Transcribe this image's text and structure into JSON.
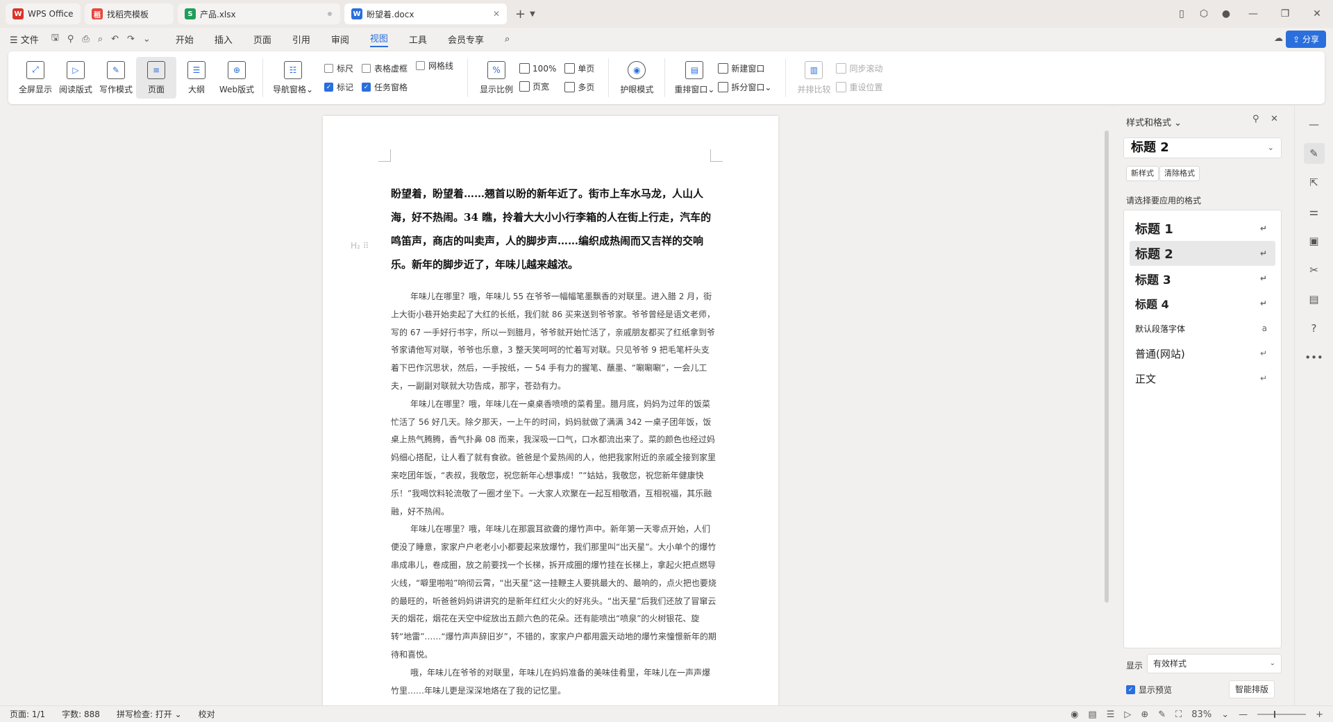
{
  "tabs": [
    {
      "label": "WPS Office",
      "icon": "wps-logo-icon",
      "color": "#d9342b"
    },
    {
      "label": "找稻壳模板",
      "icon": "docer-icon",
      "color": "#e8453c"
    },
    {
      "label": "产品.xlsx",
      "icon": "sheet-icon",
      "color": "#1e9e5a"
    },
    {
      "label": "盼望着.docx",
      "icon": "writer-icon",
      "color": "#2a6fdc"
    }
  ],
  "menu": {
    "file": "文件",
    "items": [
      "开始",
      "插入",
      "页面",
      "引用",
      "审阅",
      "视图",
      "工具",
      "会员专享"
    ],
    "active": "视图",
    "share": "分享"
  },
  "ribbon": {
    "views": [
      {
        "label": "全屏显示",
        "icon": "fullscreen-icon"
      },
      {
        "label": "阅读版式",
        "icon": "read-mode-icon"
      },
      {
        "label": "写作模式",
        "icon": "write-mode-icon"
      },
      {
        "label": "页面",
        "icon": "page-view-icon",
        "active": true
      },
      {
        "label": "大纲",
        "icon": "outline-icon"
      },
      {
        "label": "Web版式",
        "icon": "web-layout-icon"
      }
    ],
    "nav_pane": "导航窗格",
    "checks_col1": [
      {
        "label": "标尺",
        "checked": false
      },
      {
        "label": "标记",
        "checked": true
      }
    ],
    "checks_col2": [
      {
        "label": "表格虚框",
        "checked": false
      },
      {
        "label": "任务窗格",
        "checked": true
      }
    ],
    "checks_col3": [
      {
        "label": "网格线",
        "checked": false
      }
    ],
    "zoom_label": "显示比例",
    "zoom_100": "100%",
    "page_width": "页宽",
    "single_page": "单页",
    "multi_page": "多页",
    "eye_mode": "护眼模式",
    "rearrange": "重排窗口",
    "new_window": "新建窗口",
    "split_window": "拆分窗口",
    "side_by_side": "并排比较",
    "sync_scroll": "同步滚动",
    "reset_pos": "重设位置"
  },
  "document": {
    "heading": "盼望着，盼望着……翘首以盼的新年近了。街市上车水马龙，人山人海，好不热闹。34 瞧，拎着大大小小行李箱的人在街上行走，汽车的鸣笛声，商店的叫卖声，人的脚步声……编织成热闹而又吉祥的交响乐。新年的脚步近了，年味儿越来越浓。",
    "h2_marker": "H₂ ⠿",
    "paragraphs": [
      "年味儿在哪里？哦，年味儿 55 在爷爷一幅幅笔墨飘香的对联里。进入腊 2 月，街上大街小巷开始卖起了大红的长纸，我们就 86 买来送到爷爷家。爷爷曾经是语文老师，写的 67 一手好行书字，所以一到腊月，爷爷就开始忙活了，亲戚朋友都买了红纸拿到爷爷家请他写对联，爷爷也乐意，3 整天笑呵呵的忙着写对联。只见爷爷 9 把毛笔杆头支着下巴作沉思状，然后，一手按纸，一 54 手有力的握笔、蘸墨、“唰唰唰”，一会儿工夫，一副副对联就大功告成，那字，苍劲有力。",
      "年味儿在哪里？哦，年味儿在一桌桌香喷喷的菜肴里。腊月底，妈妈为过年的饭菜忙活了 56 好几天。除夕那天，一上午的时间，妈妈就做了满满 342 一桌子团年饭，饭桌上热气腾腾，香气扑鼻 08 而来，我深吸一口气，口水都流出来了。菜的颜色也经过妈妈细心搭配，让人看了就有食欲。爸爸是个爱热闹的人，他把我家附近的亲戚全接到家里来吃团年饭，“表叔，我敬您，祝您新年心想事成！”“姑姑，我敬您，祝您新年健康快乐！”我喝饮料轮流敬了一圈才坐下。一大家人欢聚在一起互相敬酒，互相祝福，其乐融融，好不热闹。",
      "年味儿在哪里？哦，年味儿在那震耳欲聋的爆竹声中。新年第一天零点开始，人们便没了睡意，家家户户老老小小都要起来放爆竹，我们那里叫“出天星”。大小单个的爆竹串成串儿，卷成圈，放之前要找一个长梯，拆开成圈的爆竹挂在长梯上，拿起火把点燃导火线，“噼里啪啦”响彻云霄，“出天星”这一挂鞭主人要挑最大的、最响的，点火把也要烧的最旺的，听爸爸妈妈讲讲究的是新年红红火火的好兆头。“出天星”后我们还放了冒窜云天的烟花，烟花在天空中绽放出五颜六色的花朵。还有能喷出“喷泉”的火树银花、旋转“地雷”……“爆竹声声辞旧岁”，不错的，家家户户都用震天动地的爆竹来憧憬新年的期待和喜悦。",
      "哦，年味儿在爷爷的对联里，年味儿在妈妈准备的美味佳肴里，年味儿在一声声爆竹里……年味儿更是深深地烙在了我的记忆里。"
    ]
  },
  "style_panel": {
    "title": "样式和格式",
    "current": "标题  2",
    "new_style": "新样式",
    "clear_format": "清除格式",
    "choose_label": "请选择要应用的格式",
    "styles": [
      {
        "label": "标题  1",
        "mark": "↵",
        "size": 18,
        "bold": true
      },
      {
        "label": "标题  2",
        "mark": "↵",
        "size": 18,
        "bold": true,
        "selected": true
      },
      {
        "label": "标题  3",
        "mark": "↵",
        "size": 17,
        "bold": true
      },
      {
        "label": "标题  4",
        "mark": "↵",
        "size": 16,
        "bold": true
      },
      {
        "label": "默认段落字体",
        "mark": "a",
        "size": 12,
        "bold": false
      },
      {
        "label": "普通(网站)",
        "mark": "↵",
        "size": 15,
        "bold": false
      },
      {
        "label": "正文",
        "mark": "↵",
        "size": 15,
        "bold": false
      }
    ],
    "show_label": "显示",
    "show_value": "有效样式",
    "preview_label": "显示预览",
    "preview_checked": true,
    "smart_layout": "智能排版"
  },
  "statusbar": {
    "page": "页面: 1/1",
    "words": "字数: 888",
    "spell": "拼写检查: 打开 ⌄",
    "proof": "校对",
    "zoom": "83%"
  }
}
